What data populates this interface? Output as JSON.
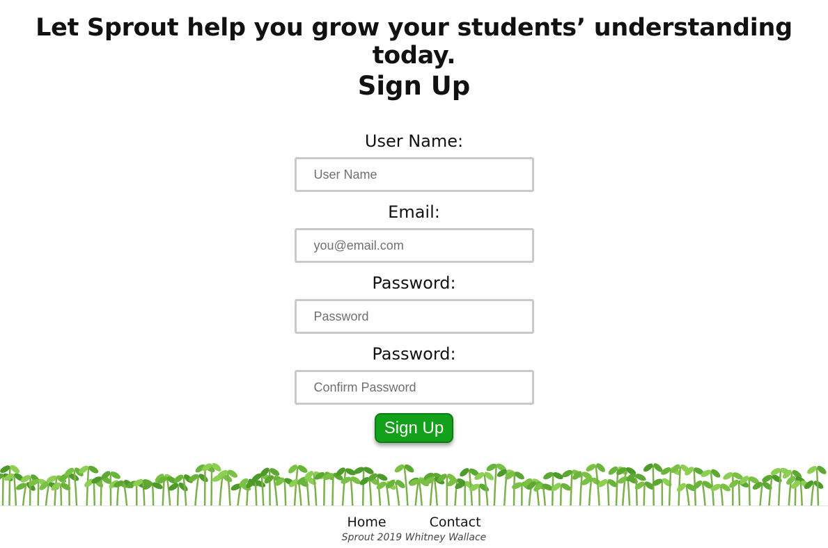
{
  "header": {
    "tagline": "Let Sprout help you grow your students’ understanding today."
  },
  "form": {
    "title": "Sign Up",
    "fields": [
      {
        "label": "User Name:",
        "placeholder": "User Name",
        "value": ""
      },
      {
        "label": "Email:",
        "placeholder": "you@email.com",
        "value": ""
      },
      {
        "label": "Password:",
        "placeholder": "Password",
        "value": ""
      },
      {
        "label": "Password:",
        "placeholder": "Confirm Password",
        "value": ""
      }
    ],
    "submit_label": "Sign Up"
  },
  "decoration": {
    "icon": "sprouts-border-icon"
  },
  "footer": {
    "links": [
      {
        "label": "Home"
      },
      {
        "label": "Contact"
      }
    ],
    "copyright": "Sprout 2019 Whitney Wallace"
  },
  "colors": {
    "button_green": "#13a01b",
    "sprout_green": "#6dbb3f",
    "input_border": "#c9c9c9"
  }
}
